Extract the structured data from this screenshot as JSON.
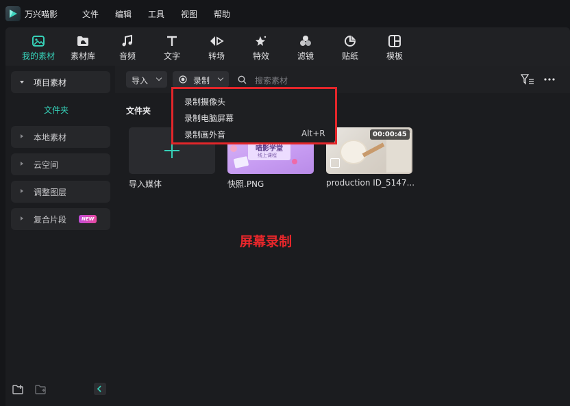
{
  "app": {
    "name": "万兴喵影"
  },
  "menu": [
    "文件",
    "编辑",
    "工具",
    "视图",
    "帮助"
  ],
  "toolbar": {
    "items": [
      {
        "label": "我的素材",
        "icon": "my-media-icon",
        "active": true
      },
      {
        "label": "素材库",
        "icon": "stock-library-icon"
      },
      {
        "label": "音频",
        "icon": "music-note-icon"
      },
      {
        "label": "文字",
        "icon": "text-t-icon"
      },
      {
        "label": "转场",
        "icon": "transition-arrows-icon"
      },
      {
        "label": "特效",
        "icon": "effects-star-icon"
      },
      {
        "label": "滤镜",
        "icon": "filter-circles-icon"
      },
      {
        "label": "贴纸",
        "icon": "sticker-icon"
      },
      {
        "label": "模板",
        "icon": "template-grid-icon"
      }
    ]
  },
  "sidebar": {
    "items": [
      {
        "label": "项目素材",
        "expanded": true
      },
      {
        "label": "本地素材"
      },
      {
        "label": "云空间"
      },
      {
        "label": "调整图层"
      },
      {
        "label": "复合片段",
        "badge": "NEW"
      }
    ],
    "sub_item": "文件夹"
  },
  "content_bar": {
    "import_label": "导入",
    "record_label": "录制",
    "search_placeholder": "搜索素材"
  },
  "record_menu": [
    {
      "label": "录制摄像头",
      "shortcut": ""
    },
    {
      "label": "录制电脑屏幕",
      "shortcut": ""
    },
    {
      "label": "录制画外音",
      "shortcut": "Alt+R"
    }
  ],
  "folder_title": "文件夹",
  "media": [
    {
      "label": "导入媒体"
    },
    {
      "label": "快照.PNG",
      "thumb_text": "喵影学堂",
      "thumb_subtext": "线上课程"
    },
    {
      "label": "production ID_5147...",
      "duration": "00:00:45"
    }
  ],
  "annotation": "屏幕录制",
  "colors": {
    "accent": "#36d1b8",
    "highlight": "#e3262a",
    "badge_from": "#c04bd6",
    "badge_to": "#e84aa0"
  }
}
